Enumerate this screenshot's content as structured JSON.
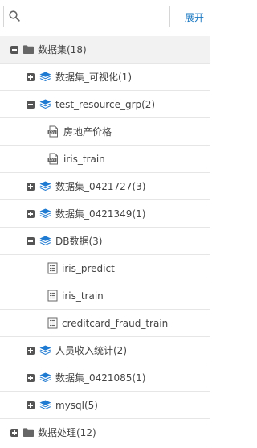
{
  "search": {
    "placeholder": "",
    "value": ""
  },
  "toolbar": {
    "expand_label": "展开"
  },
  "tree": {
    "root1": {
      "label": "数据集(18)",
      "expanded": true
    },
    "items": [
      {
        "label": "数据集_可视化(1)",
        "icon": "layers-icon",
        "state": "collapsed"
      },
      {
        "label": "test_resource_grp(2)",
        "icon": "layers-icon",
        "state": "expanded"
      },
      {
        "label": "房地产价格",
        "icon": "csv-file-icon",
        "state": "leaf"
      },
      {
        "label": "iris_train",
        "icon": "csv-file-icon",
        "state": "leaf"
      },
      {
        "label": "数据集_0421727(3)",
        "icon": "layers-icon",
        "state": "collapsed"
      },
      {
        "label": "数据集_0421349(1)",
        "icon": "layers-icon",
        "state": "collapsed"
      },
      {
        "label": "DB数据(3)",
        "icon": "layers-icon",
        "state": "expanded"
      },
      {
        "label": "iris_predict",
        "icon": "table-file-icon",
        "state": "leaf"
      },
      {
        "label": "iris_train",
        "icon": "table-file-icon",
        "state": "leaf"
      },
      {
        "label": "creditcard_fraud_train",
        "icon": "table-file-icon",
        "state": "leaf"
      },
      {
        "label": "人员收入统计(2)",
        "icon": "layers-icon",
        "state": "collapsed"
      },
      {
        "label": "数据集_0421085(1)",
        "icon": "layers-icon",
        "state": "collapsed"
      },
      {
        "label": "mysql(5)",
        "icon": "layers-icon",
        "state": "collapsed"
      }
    ],
    "root2": {
      "label": "数据处理(12)",
      "expanded": false
    }
  },
  "colors": {
    "accent": "#1a78c2",
    "layers_icon": "#1f7ad1",
    "root_row_bg": "#f2f2f2",
    "divider": "#e6e6e6"
  }
}
